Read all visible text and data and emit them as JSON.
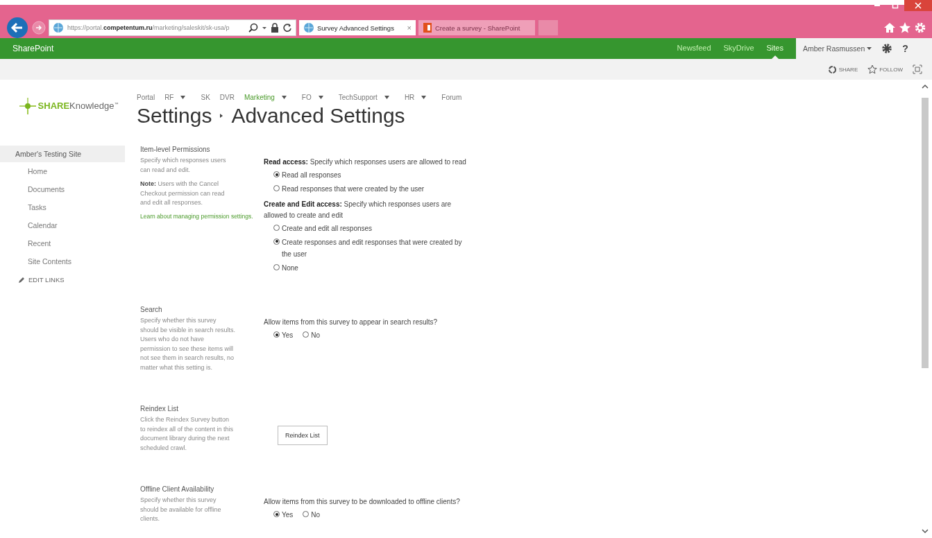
{
  "browser": {
    "url": {
      "scheme": "https://",
      "subdomain": "portal.",
      "domain": "competentum.ru",
      "path": "/marketing/saleskit/sk-usa/p"
    },
    "tabs": [
      {
        "title": "Survey Advanced Settings",
        "selected": true,
        "close": "×"
      },
      {
        "title": "Create a survey - SharePoint",
        "selected": false
      }
    ]
  },
  "suite_bar": {
    "brand": "SharePoint",
    "links": [
      {
        "label": "Newsfeed",
        "selected": false
      },
      {
        "label": "SkyDrive",
        "selected": false
      },
      {
        "label": "Sites",
        "selected": true
      }
    ],
    "user": "Amber Rasmussen",
    "help": "?"
  },
  "ribbon": {
    "actions": [
      {
        "label": "SHARE",
        "kind": "share"
      },
      {
        "label": "FOLLOW",
        "kind": "follow"
      }
    ]
  },
  "logo": {
    "bold": "SHARE",
    "rest": "Knowledge",
    "mark": "™"
  },
  "top_nav": [
    {
      "label": "Portal",
      "dropdown": false,
      "selected": false
    },
    {
      "label": "RF",
      "dropdown": true,
      "selected": false
    },
    {
      "label": "SK",
      "dropdown": false,
      "selected": false
    },
    {
      "label": "DVR",
      "dropdown": false,
      "selected": false
    },
    {
      "label": "Marketing",
      "dropdown": true,
      "selected": true
    },
    {
      "label": "FO",
      "dropdown": true,
      "selected": false
    },
    {
      "label": "TechSupport",
      "dropdown": true,
      "selected": false
    },
    {
      "label": "HR",
      "dropdown": true,
      "selected": false
    },
    {
      "label": "Forum",
      "dropdown": false,
      "selected": false
    }
  ],
  "page_title": {
    "parent": "Settings",
    "current": "Advanced Settings"
  },
  "quick_launch": {
    "site": "Amber's Testing Site",
    "items": [
      "Home",
      "Documents",
      "Tasks",
      "Calendar",
      "Recent",
      "Site Contents"
    ],
    "edit_links": "EDIT LINKS"
  },
  "sections": [
    {
      "title": "Item-level Permissions",
      "description": [
        "Specify which responses users can read and edit.",
        "**Note:** Users with the Cancel Checkout permission can read and edit all responses."
      ],
      "link": "Learn about managing permission settings.",
      "controls": [
        {
          "kind": "radio_group",
          "inline": false,
          "label": "**Read access:**  Specify which responses users are allowed to read",
          "options": [
            {
              "label": "Read all responses",
              "selected": true
            },
            {
              "label": "Read responses that were created by the user",
              "selected": false
            }
          ]
        },
        {
          "kind": "radio_group",
          "inline": false,
          "label": "**Create and Edit access:**  Specify which responses users are allowed to create and edit",
          "options": [
            {
              "label": "Create and edit all responses",
              "selected": false
            },
            {
              "label": "Create responses and edit responses that were created by the user",
              "selected": true
            },
            {
              "label": "None",
              "selected": false
            }
          ]
        }
      ]
    },
    {
      "title": "Search",
      "description": [
        "Specify whether this survey should be visible in search results. Users who do not have permission to see these items will not see them in search results, no matter what this setting is."
      ],
      "controls": [
        {
          "kind": "radio_group",
          "inline": true,
          "label": "Allow items from this survey to appear in search results?",
          "options": [
            {
              "label": "Yes",
              "selected": true
            },
            {
              "label": "No",
              "selected": false
            }
          ]
        }
      ]
    },
    {
      "title": "Reindex List",
      "description": [
        "Click the Reindex Survey button to reindex all of the content in this document library during the next scheduled crawl."
      ],
      "controls": [
        {
          "kind": "button",
          "label": "Reindex List"
        }
      ]
    },
    {
      "title": "Offline Client Availability",
      "description": [
        "Specify whether this survey should be available for offline clients."
      ],
      "controls": [
        {
          "kind": "radio_group",
          "inline": true,
          "label": "Allow items from this survey to be downloaded to offline clients?",
          "options": [
            {
              "label": "Yes",
              "selected": true
            },
            {
              "label": "No",
              "selected": false
            }
          ]
        }
      ]
    }
  ]
}
